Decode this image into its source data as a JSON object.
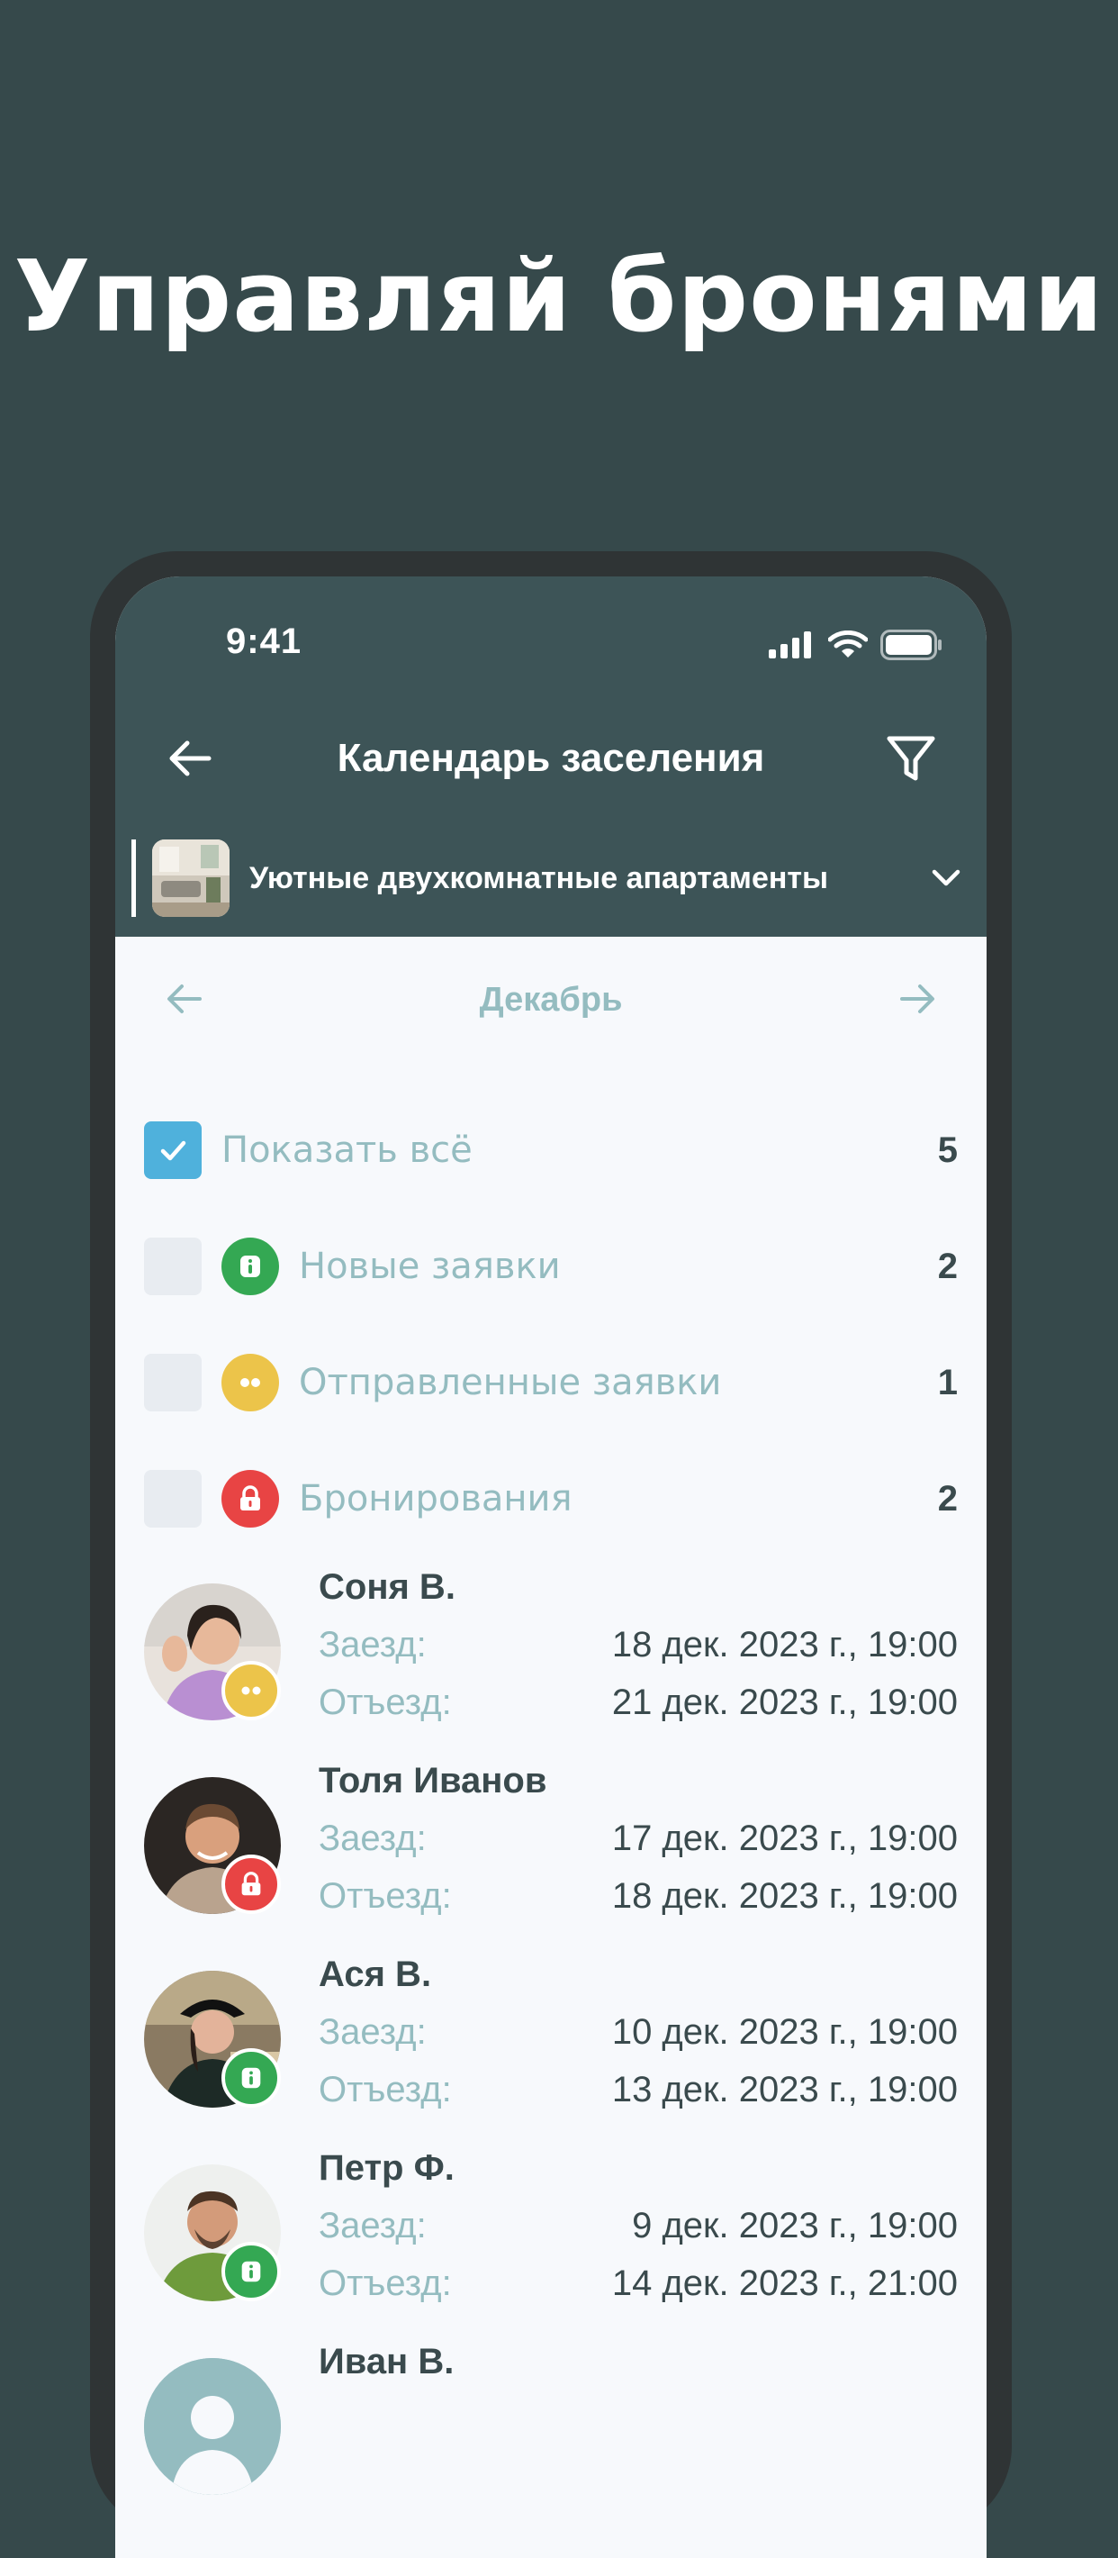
{
  "headline": "Управляй бронями",
  "status_bar": {
    "time": "9:41"
  },
  "nav": {
    "title": "Календарь заселения"
  },
  "property": {
    "name": "Уютные двухкомнатные апартаменты"
  },
  "month": "Декабрь",
  "filters": [
    {
      "label": "Показать всё",
      "count": "5",
      "checked": true,
      "status": null
    },
    {
      "label": "Новые заявки",
      "count": "2",
      "checked": false,
      "status": "green"
    },
    {
      "label": "Отправленные заявки",
      "count": "1",
      "checked": false,
      "status": "yellow"
    },
    {
      "label": "Бронирования",
      "count": "2",
      "checked": false,
      "status": "red"
    }
  ],
  "labels": {
    "checkin": "Заезд:",
    "checkout": "Отъезд:"
  },
  "bookings": [
    {
      "name": "Соня В.",
      "checkin": "18 дек. 2023 г., 19:00",
      "checkout": "21 дек. 2023 г., 19:00",
      "status": "yellow"
    },
    {
      "name": "Толя Иванов",
      "checkin": "17 дек. 2023 г., 19:00",
      "checkout": "18 дек. 2023 г., 19:00",
      "status": "red"
    },
    {
      "name": "Ася В.",
      "checkin": "10 дек. 2023 г., 19:00",
      "checkout": "13 дек. 2023 г., 19:00",
      "status": "green"
    },
    {
      "name": "Петр Ф.",
      "checkin": "9 дек. 2023 г., 19:00",
      "checkout": "14 дек. 2023 г., 21:00",
      "status": "green"
    },
    {
      "name": "Иван В.",
      "checkin": "",
      "checkout": "",
      "status": null
    }
  ],
  "colors": {
    "background": "#36494b",
    "header": "#3d5457",
    "accent": "#4fb1dc",
    "new": "#34a853",
    "sent": "#ecc44a",
    "booked": "#e84444",
    "muted": "#94bcc0",
    "text": "#3a4a4d"
  },
  "icons": [
    "back-arrow-icon",
    "filter-icon",
    "chevron-down-icon",
    "arrow-left-icon",
    "arrow-right-icon",
    "check-icon",
    "info-icon",
    "dots-icon",
    "lock-icon",
    "signal-icon",
    "wifi-icon",
    "battery-icon"
  ]
}
